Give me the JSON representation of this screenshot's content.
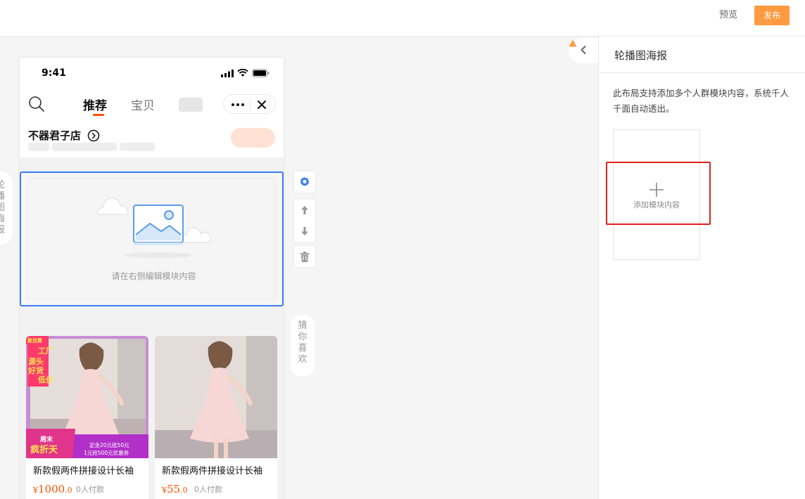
{
  "header": {
    "preview_label": "预览",
    "publish_label": "发布"
  },
  "canvas": {
    "left_side_tab": [
      "轮",
      "播",
      "图",
      "海",
      "报"
    ],
    "right_side_tab": [
      "猜",
      "你",
      "喜",
      "欢"
    ]
  },
  "phone": {
    "status_time": "9:41",
    "tabs": [
      "推荐",
      "宝贝"
    ],
    "shop_name": "不器君子店",
    "carousel_placeholder": "请在右侧编辑模块内容",
    "products": [
      {
        "title": "新款假两件拼接设计长袖",
        "currency": "¥",
        "price_int": "1000",
        "price_dec": ".0",
        "sold": "0人付款",
        "promo": {
          "corner": "聚划算",
          "vertical_tags": [
            "工厂",
            "源头",
            "好货",
            "低价"
          ],
          "badge_top": "周末",
          "badge_main": "疯折天",
          "coupon_line1": "定金20元抵50元",
          "coupon_line2": "1元抢500元优惠券"
        }
      },
      {
        "title": "新款假两件拼接设计长袖",
        "currency": "¥",
        "price_int": "55",
        "price_dec": ".0",
        "sold": "0人付款"
      }
    ]
  },
  "panel": {
    "title": "轮播图海报",
    "description": "此布局支持添加多个人群模块内容，系统千人千面自动透出。",
    "add_module_label": "添加模块内容"
  },
  "colors": {
    "accent_orange": "#ff9a40",
    "price_orange": "#ff5000",
    "selection_blue": "#3b7cf5",
    "highlight_red": "#e02020"
  },
  "icons": {
    "search": "search-icon",
    "more": "more-icon",
    "close": "close-icon",
    "gear": "gear-icon",
    "arrow_up": "arrow-up-icon",
    "arrow_down": "arrow-down-icon",
    "trash": "trash-icon",
    "chevron_left": "chevron-left-icon",
    "warning": "warning-icon",
    "plus": "plus-icon"
  }
}
